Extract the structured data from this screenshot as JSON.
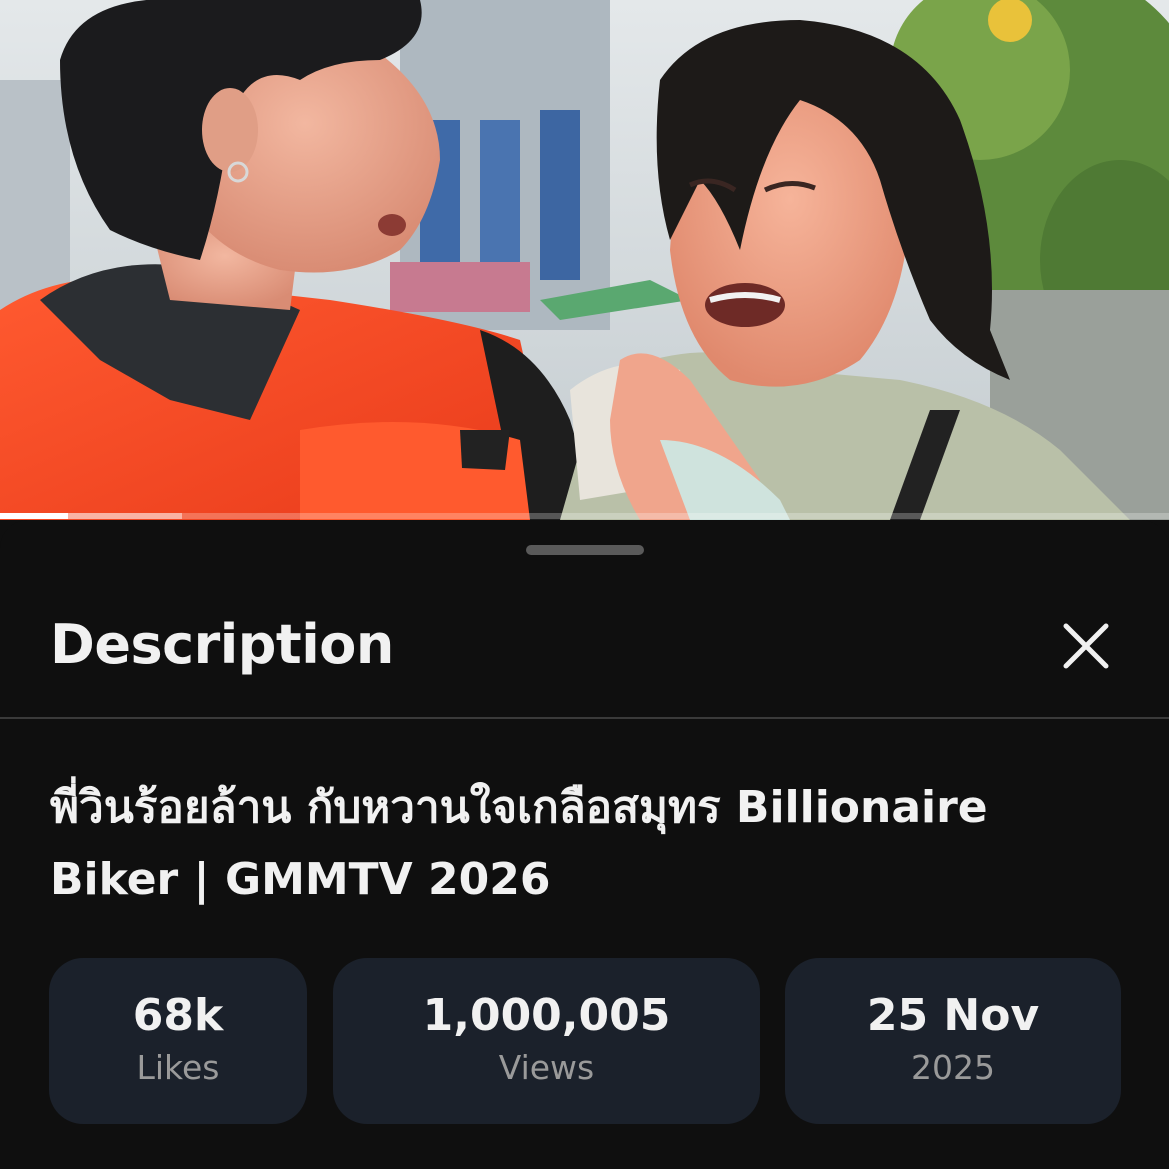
{
  "player": {
    "progress_played": 0.058,
    "progress_buffered": 0.156
  },
  "sheet": {
    "title": "Description",
    "close_icon": "close-icon"
  },
  "video": {
    "title": "พี่วินร้อยล้าน กับหวานใจเกลือสมุทร Billionaire Biker | GMMTV 2026"
  },
  "stats": {
    "likes": {
      "value": "68k",
      "label": "Likes"
    },
    "views": {
      "value": "1,000,005",
      "label": "Views"
    },
    "date": {
      "value": "25 Nov",
      "label": "2025"
    }
  },
  "colors": {
    "background": "#0f0f0f",
    "card": "#1b212b",
    "text_primary": "#f1f1f1",
    "text_secondary": "#9a9a9a",
    "divider": "#3a3a3a",
    "vest_orange": "#ff4a22"
  }
}
